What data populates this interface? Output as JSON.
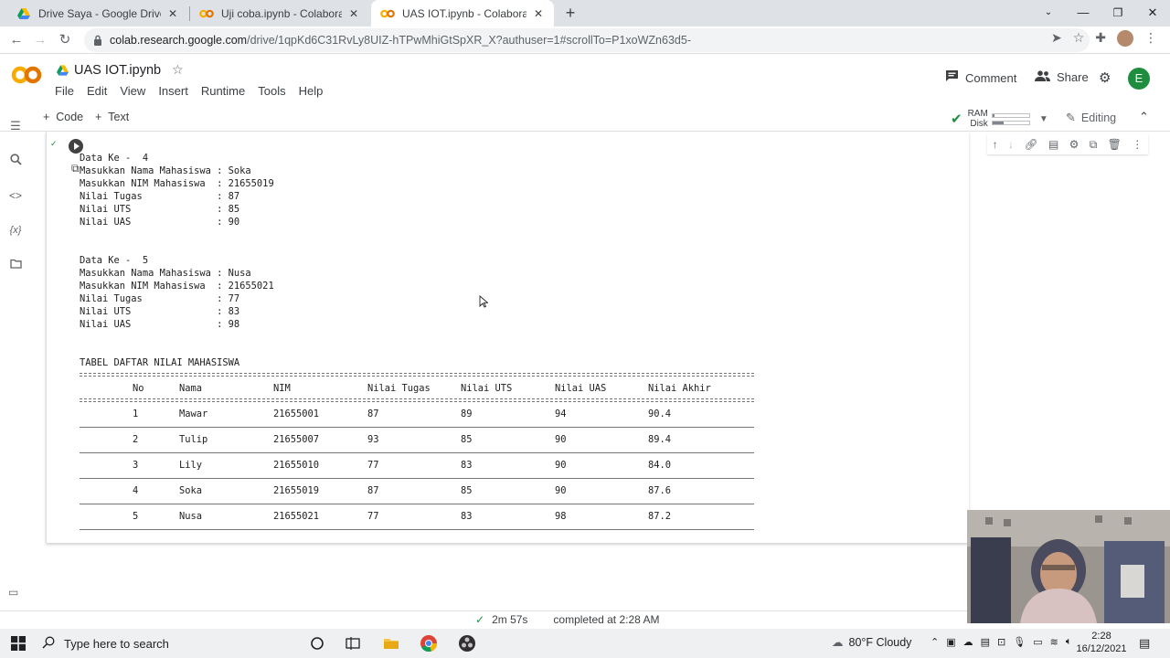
{
  "browser": {
    "tabs": [
      {
        "title": "Drive Saya - Google Drive",
        "active": false
      },
      {
        "title": "Uji coba.ipynb - Colaboratory",
        "active": false
      },
      {
        "title": "UAS IOT.ipynb - Colaboratory",
        "active": true
      }
    ],
    "url_host": "colab.research.google.com",
    "url_path": "/drive/1qpKd6C31RvLy8UIZ-hTPwMhiGtSpXR_X?authuser=1#scrollTo=P1xoWZn63d5-"
  },
  "colab": {
    "logo": "CO",
    "notebook_title": "UAS IOT.ipynb",
    "menu": [
      "File",
      "Edit",
      "View",
      "Insert",
      "Runtime",
      "Tools",
      "Help"
    ],
    "comment_label": "Comment",
    "share_label": "Share",
    "avatar_letter": "E",
    "toolbar": {
      "code_label": "Code",
      "text_label": "Text",
      "ram_label": "RAM",
      "disk_label": "Disk",
      "ram_level": 0.05,
      "disk_level": 0.3,
      "editing_label": "Editing"
    }
  },
  "output": {
    "records": [
      {
        "header": "Data Ke -  4",
        "lines": [
          "Masukkan Nama Mahasiswa : Soka",
          "Masukkan NIM Mahasiswa  : 21655019",
          "Nilai Tugas             : 87",
          "Nilai UTS               : 85",
          "Nilai UAS               : 90"
        ]
      },
      {
        "header": "Data Ke -  5",
        "lines": [
          "Masukkan Nama Mahasiswa : Nusa",
          "Masukkan NIM Mahasiswa  : 21655021",
          "Nilai Tugas             : 77",
          "Nilai UTS               : 83",
          "Nilai UAS               : 98"
        ]
      }
    ],
    "table_title": "TABEL DAFTAR NILAI MAHASISWA",
    "table_headers": [
      "No",
      "Nama",
      "NIM",
      "Nilai Tugas",
      "Nilai UTS",
      "Nilai UAS",
      "Nilai Akhir"
    ],
    "table_rows": [
      [
        "1",
        "Mawar",
        "21655001",
        "87",
        "89",
        "94",
        "90.4"
      ],
      [
        "2",
        "Tulip",
        "21655007",
        "93",
        "85",
        "90",
        "89.4"
      ],
      [
        "3",
        "Lily",
        "21655010",
        "77",
        "83",
        "90",
        "84.0"
      ],
      [
        "4",
        "Soka",
        "21655019",
        "87",
        "85",
        "90",
        "87.6"
      ],
      [
        "5",
        "Nusa",
        "21655021",
        "77",
        "83",
        "98",
        "87.2"
      ]
    ]
  },
  "status": {
    "duration": "2m 57s",
    "completed": "completed at 2:28 AM"
  },
  "taskbar": {
    "search_placeholder": "Type here to search",
    "weather": "80°F  Cloudy",
    "time": "2:28",
    "date": "16/12/2021"
  },
  "colors": {
    "colab_orange": "#f9ab00",
    "accent_green": "#1e8e3e",
    "chrome_blue": "#1a73e8"
  }
}
